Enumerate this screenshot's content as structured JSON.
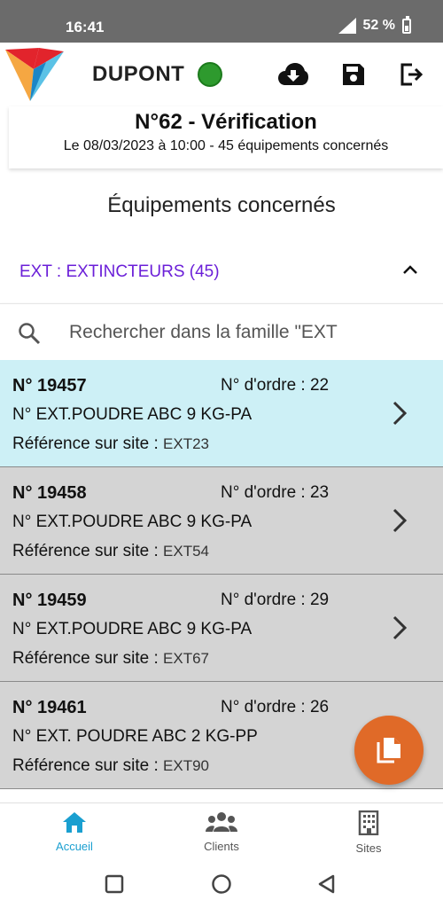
{
  "status_bar": {
    "time": "16:41",
    "battery": "52 %"
  },
  "header": {
    "user_name": "DUPONT",
    "online_color": "#2e9a2e",
    "icons": [
      "cloud-download-icon",
      "save-icon",
      "logout-icon"
    ]
  },
  "visit": {
    "title": "N°62 - Vérification",
    "subtitle": "Le 08/03/2023 à 10:00 - 45 équipements concernés"
  },
  "section": {
    "title": "Équipements concernés"
  },
  "family": {
    "label": "EXT : EXTINCTEURS (45)",
    "color": "#6b1fd8"
  },
  "search": {
    "placeholder": "Rechercher dans la famille \"EXT"
  },
  "equipments": [
    {
      "number": "N° 19457",
      "order": "N° d'ordre : 22",
      "description": "N° EXT.POUDRE ABC 9 KG-PA",
      "ref_label": "Référence sur site : ",
      "ref_value": "EXT23",
      "selected": true
    },
    {
      "number": "N° 19458",
      "order": "N° d'ordre : 23",
      "description": "N° EXT.POUDRE ABC 9 KG-PA",
      "ref_label": "Référence sur site : ",
      "ref_value": "EXT54",
      "selected": false
    },
    {
      "number": "N° 19459",
      "order": "N° d'ordre : 29",
      "description": "N° EXT.POUDRE ABC 9 KG-PA",
      "ref_label": "Référence sur site : ",
      "ref_value": "EXT67",
      "selected": false
    },
    {
      "number": "N° 19461",
      "order": "N° d'ordre : 26",
      "description": "N° EXT. POUDRE ABC 2 KG-PP",
      "ref_label": "Référence sur site : ",
      "ref_value": "EXT90",
      "selected": false
    }
  ],
  "fab": {
    "icon": "copy-document-icon",
    "color": "#e06a28"
  },
  "bottom_nav": {
    "items": [
      {
        "label": "Accueil",
        "icon": "home-icon",
        "active": true
      },
      {
        "label": "Clients",
        "icon": "group-icon",
        "active": false
      },
      {
        "label": "Sites",
        "icon": "building-icon",
        "active": false
      }
    ],
    "active_color": "#1a9fd0"
  },
  "system_nav": [
    "recents-button",
    "home-button",
    "back-button"
  ]
}
